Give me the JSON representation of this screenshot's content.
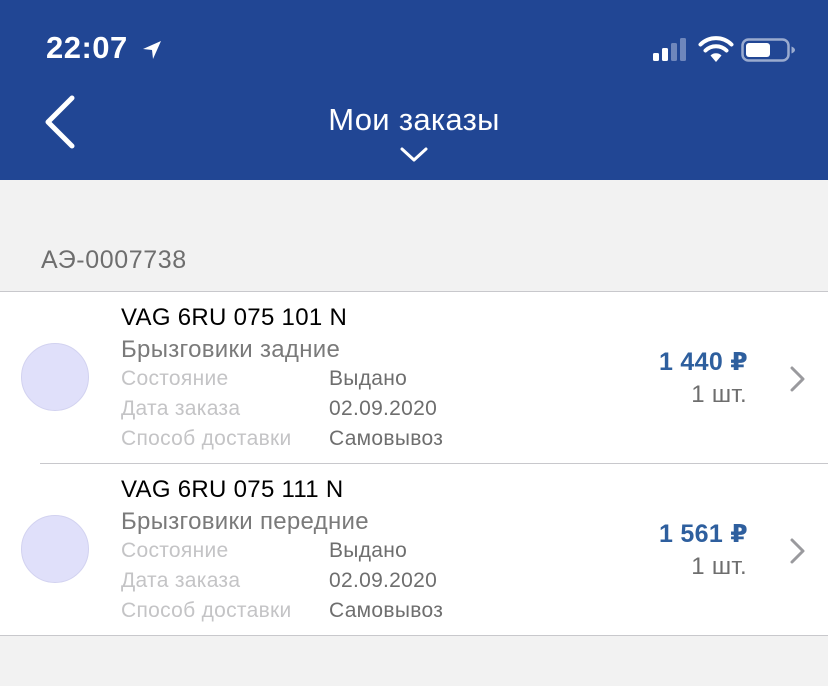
{
  "status_bar": {
    "time": "22:07",
    "icons": [
      "location-arrow-icon",
      "cellular-signal-icon",
      "wifi-icon",
      "battery-icon"
    ]
  },
  "nav": {
    "back_icon": "chevron-left-icon",
    "title": "Мои заказы",
    "dropdown_icon": "chevron-down-icon"
  },
  "order_group": {
    "number": "АЭ-0007738"
  },
  "orders": [
    {
      "code": "VAG 6RU 075 101 N",
      "name": "Брызговики задние",
      "status_label": "Состояние",
      "status_value": "Выдано",
      "date_label": "Дата заказа",
      "date_value": "02.09.2020",
      "delivery_label": "Способ доставки",
      "delivery_value": "Самовывоз",
      "price": "1 440 ₽",
      "quantity": "1 шт."
    },
    {
      "code": "VAG 6RU 075 111 N",
      "name": "Брызговики передние",
      "status_label": "Состояние",
      "status_value": "Выдано",
      "date_label": "Дата заказа",
      "date_value": "02.09.2020",
      "delivery_label": "Способ доставки",
      "delivery_value": "Самовывоз",
      "price": "1 561 ₽",
      "quantity": "1 шт."
    }
  ],
  "colors": {
    "header_background": "#214694",
    "price": "#2e5f9e",
    "page_background": "#f2f2f2",
    "thumbnail": "#e0e0fa"
  }
}
